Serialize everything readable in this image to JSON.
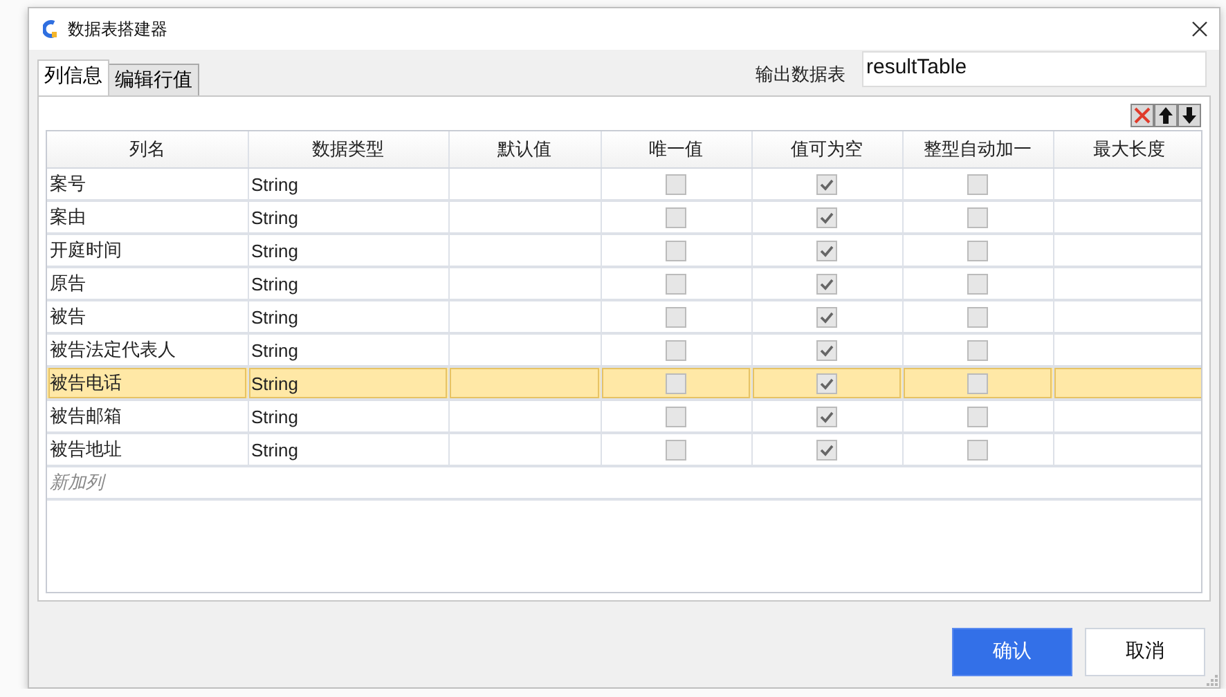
{
  "window": {
    "title": "数据表搭建器"
  },
  "tabs": [
    {
      "label": "列信息",
      "selected": true
    },
    {
      "label": "编辑行值",
      "selected": false
    }
  ],
  "output_table": {
    "label": "输出数据表",
    "value": "resultTable"
  },
  "table": {
    "columns": [
      {
        "label": "列名",
        "kind": "name"
      },
      {
        "label": "数据类型",
        "kind": "type"
      },
      {
        "label": "默认值",
        "kind": "blank"
      },
      {
        "label": "唯一值",
        "kind": "unique"
      },
      {
        "label": "值可为空",
        "kind": "nullable"
      },
      {
        "label": "整型自动加一",
        "kind": "auto_increment"
      },
      {
        "label": "最大长度",
        "kind": "blank"
      }
    ],
    "rows": [
      {
        "name": "案号",
        "type": "String",
        "unique": false,
        "nullable": true,
        "auto_increment": false,
        "selected": false
      },
      {
        "name": "案由",
        "type": "String",
        "unique": false,
        "nullable": true,
        "auto_increment": false,
        "selected": false
      },
      {
        "name": "开庭时间",
        "type": "String",
        "unique": false,
        "nullable": true,
        "auto_increment": false,
        "selected": false
      },
      {
        "name": "原告",
        "type": "String",
        "unique": false,
        "nullable": true,
        "auto_increment": false,
        "selected": false
      },
      {
        "name": "被告",
        "type": "String",
        "unique": false,
        "nullable": true,
        "auto_increment": false,
        "selected": false
      },
      {
        "name": "被告法定代表人",
        "type": "String",
        "unique": false,
        "nullable": true,
        "auto_increment": false,
        "selected": false
      },
      {
        "name": "被告电话",
        "type": "String",
        "unique": false,
        "nullable": true,
        "auto_increment": false,
        "selected": true
      },
      {
        "name": "被告邮箱",
        "type": "String",
        "unique": false,
        "nullable": true,
        "auto_increment": false,
        "selected": false
      },
      {
        "name": "被告地址",
        "type": "String",
        "unique": false,
        "nullable": true,
        "auto_increment": false,
        "selected": false
      }
    ],
    "new_row_placeholder": "新加列"
  },
  "buttons": [
    {
      "label": "确认",
      "kind": "primary"
    },
    {
      "label": "取消",
      "kind": "secondary"
    }
  ]
}
